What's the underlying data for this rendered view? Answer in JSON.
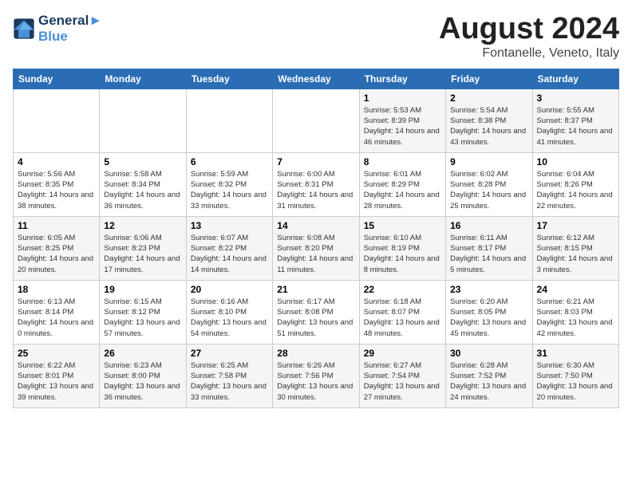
{
  "logo": {
    "line1": "General",
    "line2": "Blue"
  },
  "title": "August 2024",
  "subtitle": "Fontanelle, Veneto, Italy",
  "weekdays": [
    "Sunday",
    "Monday",
    "Tuesday",
    "Wednesday",
    "Thursday",
    "Friday",
    "Saturday"
  ],
  "weeks": [
    [
      {
        "day": "",
        "info": ""
      },
      {
        "day": "",
        "info": ""
      },
      {
        "day": "",
        "info": ""
      },
      {
        "day": "",
        "info": ""
      },
      {
        "day": "1",
        "info": "Sunrise: 5:53 AM\nSunset: 8:39 PM\nDaylight: 14 hours and 46 minutes."
      },
      {
        "day": "2",
        "info": "Sunrise: 5:54 AM\nSunset: 8:38 PM\nDaylight: 14 hours and 43 minutes."
      },
      {
        "day": "3",
        "info": "Sunrise: 5:55 AM\nSunset: 8:37 PM\nDaylight: 14 hours and 41 minutes."
      }
    ],
    [
      {
        "day": "4",
        "info": "Sunrise: 5:56 AM\nSunset: 8:35 PM\nDaylight: 14 hours and 38 minutes."
      },
      {
        "day": "5",
        "info": "Sunrise: 5:58 AM\nSunset: 8:34 PM\nDaylight: 14 hours and 36 minutes."
      },
      {
        "day": "6",
        "info": "Sunrise: 5:59 AM\nSunset: 8:32 PM\nDaylight: 14 hours and 33 minutes."
      },
      {
        "day": "7",
        "info": "Sunrise: 6:00 AM\nSunset: 8:31 PM\nDaylight: 14 hours and 31 minutes."
      },
      {
        "day": "8",
        "info": "Sunrise: 6:01 AM\nSunset: 8:29 PM\nDaylight: 14 hours and 28 minutes."
      },
      {
        "day": "9",
        "info": "Sunrise: 6:02 AM\nSunset: 8:28 PM\nDaylight: 14 hours and 25 minutes."
      },
      {
        "day": "10",
        "info": "Sunrise: 6:04 AM\nSunset: 8:26 PM\nDaylight: 14 hours and 22 minutes."
      }
    ],
    [
      {
        "day": "11",
        "info": "Sunrise: 6:05 AM\nSunset: 8:25 PM\nDaylight: 14 hours and 20 minutes."
      },
      {
        "day": "12",
        "info": "Sunrise: 6:06 AM\nSunset: 8:23 PM\nDaylight: 14 hours and 17 minutes."
      },
      {
        "day": "13",
        "info": "Sunrise: 6:07 AM\nSunset: 8:22 PM\nDaylight: 14 hours and 14 minutes."
      },
      {
        "day": "14",
        "info": "Sunrise: 6:08 AM\nSunset: 8:20 PM\nDaylight: 14 hours and 11 minutes."
      },
      {
        "day": "15",
        "info": "Sunrise: 6:10 AM\nSunset: 8:19 PM\nDaylight: 14 hours and 8 minutes."
      },
      {
        "day": "16",
        "info": "Sunrise: 6:11 AM\nSunset: 8:17 PM\nDaylight: 14 hours and 5 minutes."
      },
      {
        "day": "17",
        "info": "Sunrise: 6:12 AM\nSunset: 8:15 PM\nDaylight: 14 hours and 3 minutes."
      }
    ],
    [
      {
        "day": "18",
        "info": "Sunrise: 6:13 AM\nSunset: 8:14 PM\nDaylight: 14 hours and 0 minutes."
      },
      {
        "day": "19",
        "info": "Sunrise: 6:15 AM\nSunset: 8:12 PM\nDaylight: 13 hours and 57 minutes."
      },
      {
        "day": "20",
        "info": "Sunrise: 6:16 AM\nSunset: 8:10 PM\nDaylight: 13 hours and 54 minutes."
      },
      {
        "day": "21",
        "info": "Sunrise: 6:17 AM\nSunset: 8:08 PM\nDaylight: 13 hours and 51 minutes."
      },
      {
        "day": "22",
        "info": "Sunrise: 6:18 AM\nSunset: 8:07 PM\nDaylight: 13 hours and 48 minutes."
      },
      {
        "day": "23",
        "info": "Sunrise: 6:20 AM\nSunset: 8:05 PM\nDaylight: 13 hours and 45 minutes."
      },
      {
        "day": "24",
        "info": "Sunrise: 6:21 AM\nSunset: 8:03 PM\nDaylight: 13 hours and 42 minutes."
      }
    ],
    [
      {
        "day": "25",
        "info": "Sunrise: 6:22 AM\nSunset: 8:01 PM\nDaylight: 13 hours and 39 minutes."
      },
      {
        "day": "26",
        "info": "Sunrise: 6:23 AM\nSunset: 8:00 PM\nDaylight: 13 hours and 36 minutes."
      },
      {
        "day": "27",
        "info": "Sunrise: 6:25 AM\nSunset: 7:58 PM\nDaylight: 13 hours and 33 minutes."
      },
      {
        "day": "28",
        "info": "Sunrise: 6:26 AM\nSunset: 7:56 PM\nDaylight: 13 hours and 30 minutes."
      },
      {
        "day": "29",
        "info": "Sunrise: 6:27 AM\nSunset: 7:54 PM\nDaylight: 13 hours and 27 minutes."
      },
      {
        "day": "30",
        "info": "Sunrise: 6:28 AM\nSunset: 7:52 PM\nDaylight: 13 hours and 24 minutes."
      },
      {
        "day": "31",
        "info": "Sunrise: 6:30 AM\nSunset: 7:50 PM\nDaylight: 13 hours and 20 minutes."
      }
    ]
  ]
}
